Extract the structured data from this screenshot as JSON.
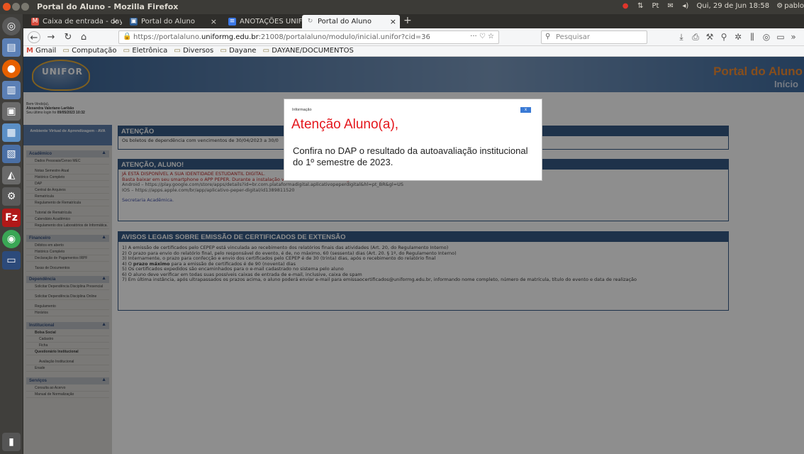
{
  "topbar": {
    "window_title": "Portal do Aluno - Mozilla Firefox",
    "tray_badge": "Pt",
    "datetime": "Qui, 29 de Jun 18:58",
    "user": "pablo"
  },
  "tabs": [
    {
      "label": "Caixa de entrada - dayan",
      "icon": "gmail-icon",
      "color": "#d54b3d",
      "active": false
    },
    {
      "label": "Portal do Aluno",
      "icon": "portal-icon",
      "color": "#2a5b94",
      "active": false
    },
    {
      "label": "ANOTAÇÕES UNIFOR - D",
      "icon": "docs-icon",
      "color": "#3b78e7",
      "active": false
    },
    {
      "label": "Portal do Aluno",
      "icon": "loading-icon",
      "color": "#888888",
      "active": true
    }
  ],
  "navbar": {
    "url_prefix": "https://portalaluno.",
    "url_domain": "uniformg.edu.br",
    "url_suffix": ":21008/portalaluno/modulo/inicial.unifor?cid=36",
    "page_actions": "··· ♡ ☆",
    "search_placeholder": "Pesquisar"
  },
  "bookmarks": [
    {
      "label": "Gmail",
      "icon": "gmail-icon"
    },
    {
      "label": "Computação",
      "icon": "folder-icon"
    },
    {
      "label": "Eletrônica",
      "icon": "folder-icon"
    },
    {
      "label": "Diversos",
      "icon": "folder-icon"
    },
    {
      "label": "Dayane",
      "icon": "folder-icon"
    },
    {
      "label": "DAYANE/DOCUMENTOS",
      "icon": "folder-icon"
    }
  ],
  "header": {
    "logo_text": "UNIFOR",
    "title": "Portal do Aluno",
    "subtitle": "Início"
  },
  "sidebar": {
    "welcome": "Bem-Vindo(a),",
    "student_name": "Alexandra Valeriano Laribão",
    "last_login_label": "Seu último login foi",
    "last_login": "09/05/2023 10:32",
    "ava": "Ambiente Virtual de Aprendizagem - AVA",
    "sections": {
      "academico": "Acadêmico",
      "financeiro": "Financeiro",
      "dependencia": "Dependência",
      "institucional": "Institucional",
      "servicos": "Serviços"
    },
    "academico_items": [
      "Dados Pessoais/Censo MEC",
      "Notas Semestre Atual",
      "Histórico Completo",
      "DAP",
      "Central de Arquivos",
      "Rematrícula",
      "Regulamento de Rematrícula",
      "Tutorial de Rematrícula",
      "Calendário Acadêmico",
      "Regulamento dos Laboratórios de Informática."
    ],
    "financeiro_items": [
      "Débitos em aberto",
      "Histórico Completo",
      "Declaração de Pagamentos IRPF",
      "Taxas de Documentos"
    ],
    "dependencia_items": [
      "Solicitar Dependência Disciplina Presencial",
      "Solicitar Dependência Disciplina Online",
      "Regulamento",
      "Horários"
    ],
    "institucional_items": {
      "bolsa": "Bolsa Social",
      "cadastro": "Cadastro",
      "ficha": "Ficha",
      "questionario": "Questionário Institucional",
      "avaliacao": "Avaliação Institucional",
      "enade": "Enade"
    },
    "servicos_items": [
      "Consulta ao Acervo",
      "Manual de Normalização"
    ]
  },
  "content": {
    "atencao": {
      "title": "ATENÇÃO",
      "text": "Os boletos de dependência com vencimentos de 30/04/2023 a 30/0"
    },
    "aluno": {
      "title": "ATENÇÃO, ALUNO!",
      "line1": "JÁ ESTÁ DISPONÍVEL A SUA IDENTIDADE ESTUDANTIL DIGITAL.",
      "line2_a": "Basta baixar em seu smartphone o APP PEPER. Durante a instalação você deverá informar o código ",
      "line2_code": "121MG003",
      "line2_b": ", o seu ",
      "line2_mat": "número de matrícula",
      "line2_c": " e sua ",
      "line2_date": "data de nascimento",
      "line2_d": ".",
      "android": "Android – https://play.google.com/store/apps/details?id=br.com.plataformadigital.aplicativopeperdigital&hl=pt_BR&gl=US",
      "ios": "IOS – https://apps.apple.com/br/app/aplicativo-peper-digital/id1389811520",
      "sign": "Secretaria Acadêmica."
    },
    "avisos": {
      "title": "AVISOS LEGAIS SOBRE EMISSÃO DE CERTIFICADOS DE EXTENSÃO",
      "l1": "1) A emissão de certificados pelo CEPEP está vinculada ao recebimento dos relatórios finais das atividades (Art. 20, do Regulamento Interno)",
      "l2": "2) O prazo para envio do relatório final, pelo responsável do evento, é de, no máximo, 60 (sessenta) dias (Art. 20. § 1º, do Regulamento Interno)",
      "l3": "3) Internamente, o prazo para confecção e envio dos certificados pelo CEPEP é de 30 (trinta) dias, após o recebimento do relatório final",
      "l4_a": "4) O ",
      "l4_b": "prazo máximo",
      "l4_c": " para a emissão de certificados é de 90 (noventa) dias",
      "l5": "5) Os certificados expedidos são encaminhados para o e-mail cadastrado no sistema pelo aluno",
      "l6": "6) O aluno deve verificar em todas suas possíveis caixas de entrada de e-mail, inclusive, caixa de spam",
      "l7": "7) Em última instância, após ultrapassados os prazos acima, o aluno poderá enviar e-mail para emissaocertificados@uniformg.edu.br, informando nome completo, número de matrícula, título do evento e data de realização"
    }
  },
  "modal": {
    "header": "Informação",
    "close": "x",
    "title": "Atenção Aluno(a),",
    "message": "Confira no DAP o resultado da autoavaliação institucional do 1º semestre de 2023."
  }
}
